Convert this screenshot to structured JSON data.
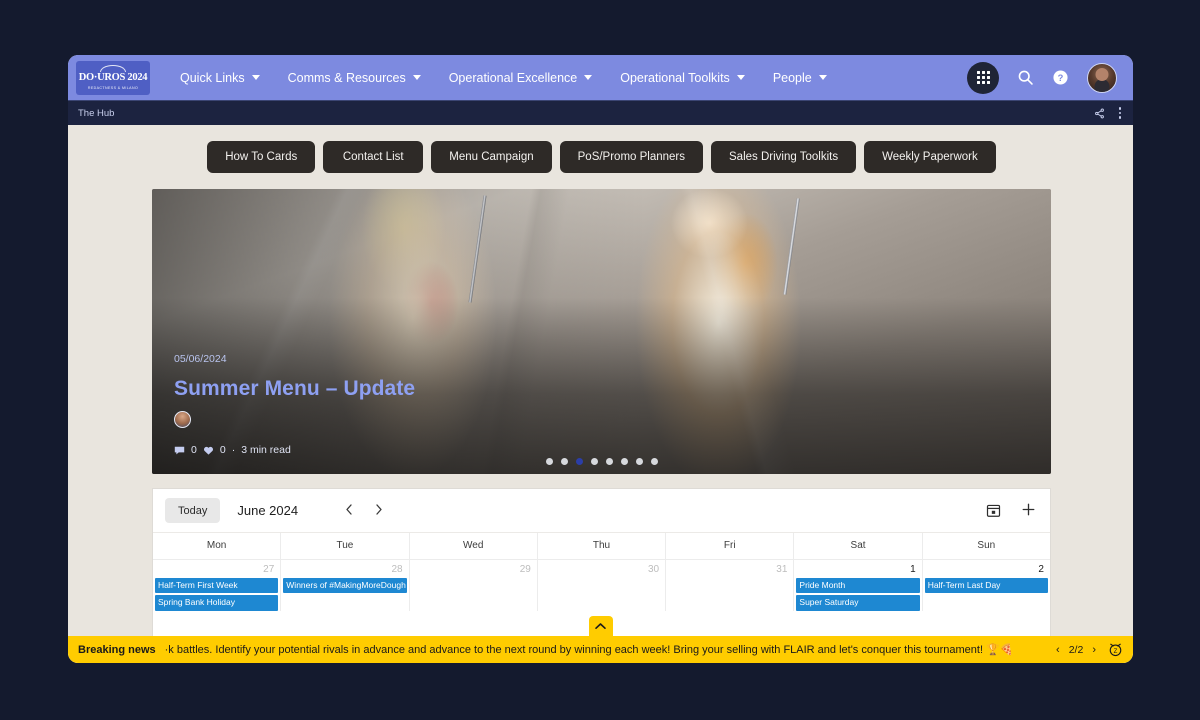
{
  "theme": {
    "nav_bg": "#7d8ae0",
    "crumb_bg": "#1c2340",
    "page_bg": "#e9e5de",
    "button_bg": "#2e2a27",
    "accent_blue": "#8ea0f2",
    "event_blue": "#1e88d2",
    "news_yellow": "#ffcc00"
  },
  "topnav": {
    "logo": {
      "swoosh": "arc-mark",
      "title": "DO·UROS 2024",
      "subtitle": "REDACTNESS & MILANO"
    },
    "items": [
      {
        "label": "Quick Links",
        "has_caret": true
      },
      {
        "label": "Comms & Resources",
        "has_caret": true
      },
      {
        "label": "Operational Excellence",
        "has_caret": true
      },
      {
        "label": "Operational Toolkits",
        "has_caret": true
      },
      {
        "label": "People",
        "has_caret": true
      }
    ],
    "icons": {
      "apps": "apps-grid-icon",
      "search": "search-icon",
      "help": "help-circle-icon",
      "avatar": "user-avatar"
    }
  },
  "breadcrumb": {
    "text": "The Hub",
    "share_icon": "share-icon",
    "more_icon": "more-vertical-icon"
  },
  "quick_buttons": [
    "How To Cards",
    "Contact List",
    "Menu Campaign",
    "PoS/Promo Planners",
    "Sales Driving Toolkits",
    "Weekly Paperwork"
  ],
  "hero": {
    "date": "05/06/2024",
    "title": "Summer Menu – Update",
    "author_avatar": "author-avatar",
    "comment_icon": "comment-icon",
    "comment_count": "0",
    "like_icon": "heart-icon",
    "like_count": "0",
    "separator": "·",
    "read_time": "3 min read",
    "dots_total": 8,
    "dots_active_index": 2
  },
  "calendar": {
    "today_label": "Today",
    "month_label": "June 2024",
    "prev_icon": "chevron-left-icon",
    "next_icon": "chevron-right-icon",
    "view_icon": "calendar-icon",
    "add_icon": "plus-icon",
    "columns": [
      {
        "dow": "Mon",
        "day": "27",
        "current_month": false,
        "events": [
          "Half-Term First Week",
          "Spring Bank Holiday"
        ]
      },
      {
        "dow": "Tue",
        "day": "28",
        "current_month": false,
        "events": [
          "Winners of #MakingMoreDough Ann"
        ]
      },
      {
        "dow": "Wed",
        "day": "29",
        "current_month": false,
        "events": []
      },
      {
        "dow": "Thu",
        "day": "30",
        "current_month": false,
        "events": []
      },
      {
        "dow": "Fri",
        "day": "31",
        "current_month": false,
        "events": []
      },
      {
        "dow": "Sat",
        "day": "1",
        "current_month": true,
        "events": [
          "Pride Month",
          "Super Saturday"
        ]
      },
      {
        "dow": "Sun",
        "day": "2",
        "current_month": true,
        "events": [
          "Half-Term Last Day"
        ]
      }
    ]
  },
  "scroll_top": {
    "icon": "chevron-up-icon"
  },
  "news": {
    "label": "Breaking news",
    "text": "·k battles. Identify your potential rivals in advance and advance to the next round by winning each week! Bring your selling with FLAIR and let's conquer this tournament! 🏆🍕",
    "prev": "‹",
    "counter": "2/2",
    "next": "›",
    "snooze_icon": "snooze-clock-icon"
  }
}
